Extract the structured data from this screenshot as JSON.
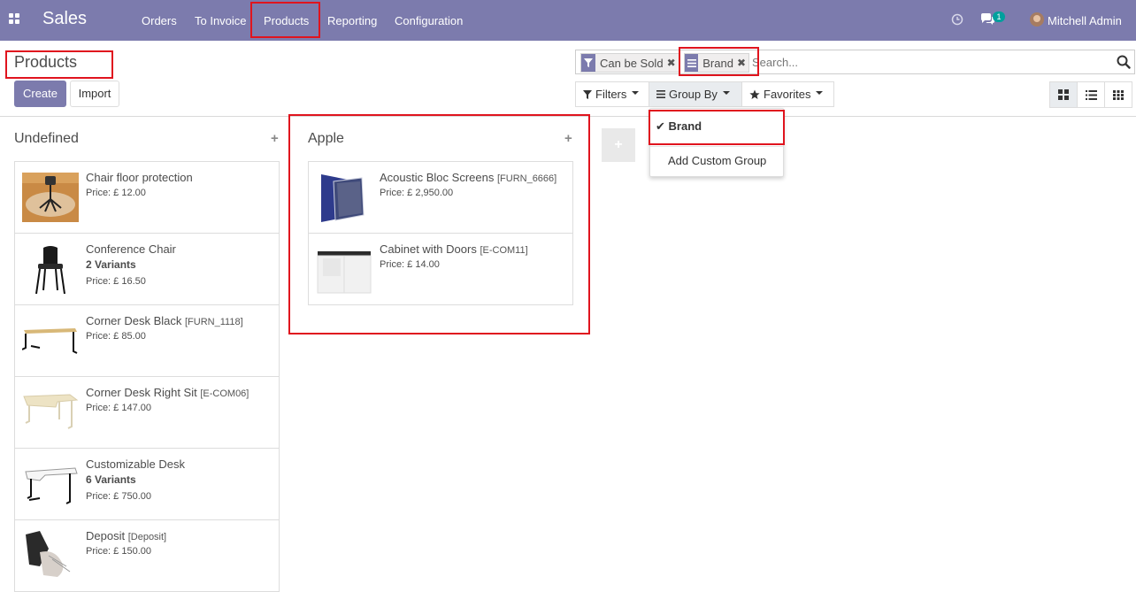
{
  "navbar": {
    "app_title": "Sales",
    "menu": [
      "Orders",
      "To Invoice",
      "Products",
      "Reporting",
      "Configuration"
    ],
    "messages_count": "1",
    "user_name": "Mitchell Admin",
    "bg_color": "#7c7bad"
  },
  "control_panel": {
    "title": "Products",
    "create_label": "Create",
    "import_label": "Import",
    "search": {
      "facets": [
        {
          "icon": "filter-icon",
          "label": "Can be Sold"
        },
        {
          "icon": "group-icon",
          "label": "Brand"
        }
      ],
      "placeholder": "Search..."
    },
    "filters_label": "Filters",
    "group_by_label": "Group By",
    "favorites_label": "Favorites"
  },
  "group_by_dropdown": {
    "items": [
      {
        "label": "Brand",
        "checked": true
      },
      {
        "label": "Add Custom Group",
        "checked": false
      }
    ]
  },
  "kanban": {
    "columns": [
      {
        "title": "Undefined",
        "cards": [
          {
            "name": "Chair floor protection",
            "ref": "",
            "variants": "",
            "price": "Price: £ 12.00",
            "image": "chair-floor-mat"
          },
          {
            "name": "Conference Chair",
            "ref": "",
            "variants": "2 Variants",
            "price": "Price: £ 16.50",
            "image": "conference-chair"
          },
          {
            "name": "Corner Desk Black",
            "ref": "[FURN_1118]",
            "variants": "",
            "price": "Price: £ 85.00",
            "image": "corner-desk-black"
          },
          {
            "name": "Corner Desk Right Sit",
            "ref": "[E-COM06]",
            "variants": "",
            "price": "Price: £ 147.00",
            "image": "corner-desk-right"
          },
          {
            "name": "Customizable Desk",
            "ref": "",
            "variants": "6 Variants",
            "price": "Price: £ 750.00",
            "image": "customizable-desk"
          },
          {
            "name": "Deposit",
            "ref": "[Deposit]",
            "variants": "",
            "price": "Price: £ 150.00",
            "image": "deposit"
          }
        ]
      },
      {
        "title": "Apple",
        "cards": [
          {
            "name": "Acoustic Bloc Screens",
            "ref": "[FURN_6666]",
            "variants": "",
            "price": "Price: £ 2,950.00",
            "image": "acoustic-screens"
          },
          {
            "name": "Cabinet with Doors",
            "ref": "[E-COM11]",
            "variants": "",
            "price": "Price: £ 14.00",
            "image": "cabinet-doors"
          }
        ]
      }
    ]
  }
}
